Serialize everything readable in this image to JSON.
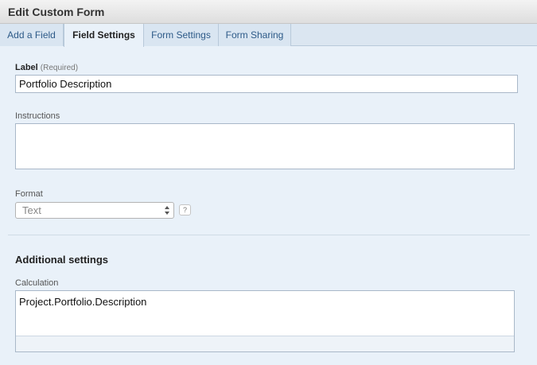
{
  "window": {
    "title": "Edit Custom Form"
  },
  "tabs": [
    {
      "label": "Add a Field"
    },
    {
      "label": "Field Settings"
    },
    {
      "label": "Form Settings"
    },
    {
      "label": "Form Sharing"
    }
  ],
  "active_tab": "Field Settings",
  "fields": {
    "label": {
      "title": "Label",
      "required_note": "(Required)",
      "value": "Portfolio Description"
    },
    "instructions": {
      "title": "Instructions",
      "value": ""
    },
    "format": {
      "title": "Format",
      "selected": "Text",
      "help": "?"
    }
  },
  "additional": {
    "title": "Additional settings",
    "calculation": {
      "title": "Calculation",
      "value": "Project.Portfolio.Description"
    }
  },
  "colors": {
    "panel_bg": "#e9f1f9",
    "tab_text": "#2d5a88",
    "border": "#a9b8c8"
  },
  "icons": {
    "select_arrows": "updown-arrows-icon",
    "help": "question-icon"
  }
}
